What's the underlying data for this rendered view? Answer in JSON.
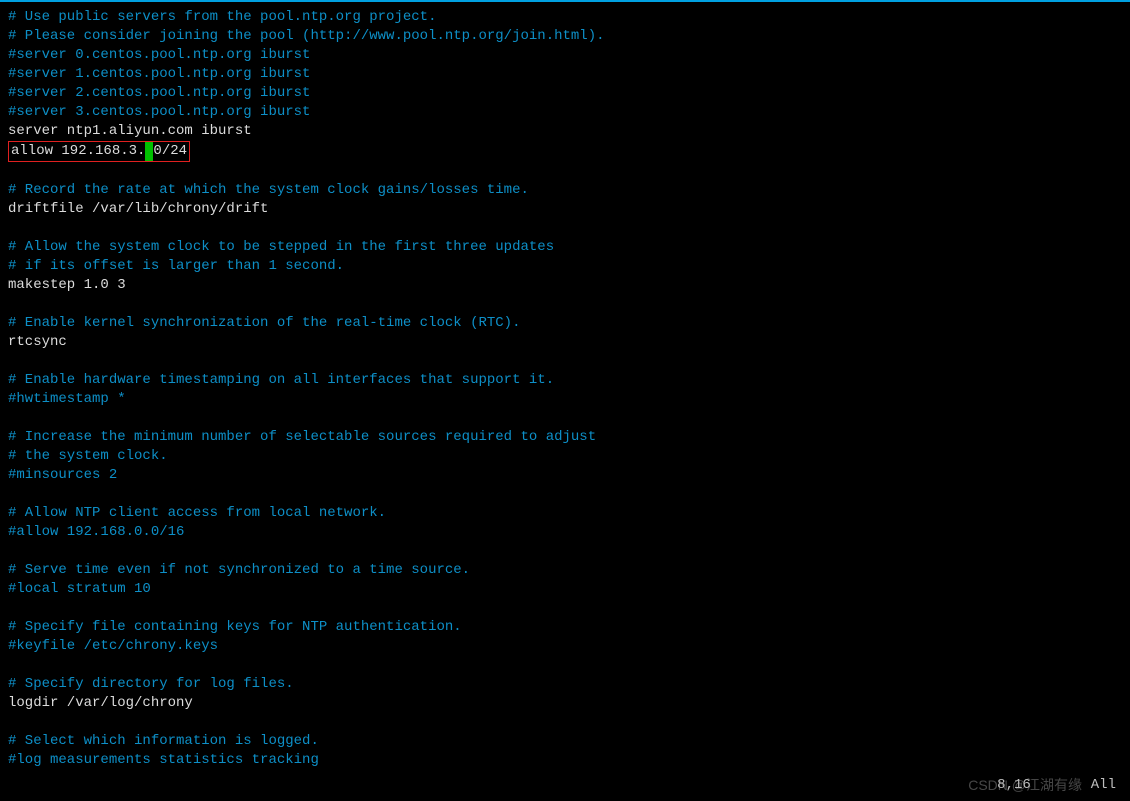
{
  "editor": {
    "cursor_position": "8,16",
    "scroll": "All",
    "highlighted_line": {
      "prefix": "allow 192.168.3.",
      "cursor_char": "0",
      "suffix": "0/24"
    },
    "lines": [
      {
        "type": "comment",
        "text": "# Use public servers from the pool.ntp.org project."
      },
      {
        "type": "comment",
        "text": "# Please consider joining the pool (http://www.pool.ntp.org/join.html)."
      },
      {
        "type": "comment",
        "text": "#server 0.centos.pool.ntp.org iburst"
      },
      {
        "type": "comment",
        "text": "#server 1.centos.pool.ntp.org iburst"
      },
      {
        "type": "comment",
        "text": "#server 2.centos.pool.ntp.org iburst"
      },
      {
        "type": "comment",
        "text": "#server 3.centos.pool.ntp.org iburst"
      },
      {
        "type": "normal",
        "text": "server ntp1.aliyun.com iburst"
      },
      {
        "type": "highlight"
      },
      {
        "type": "blank",
        "text": ""
      },
      {
        "type": "comment",
        "text": "# Record the rate at which the system clock gains/losses time."
      },
      {
        "type": "normal",
        "text": "driftfile /var/lib/chrony/drift"
      },
      {
        "type": "blank",
        "text": ""
      },
      {
        "type": "comment",
        "text": "# Allow the system clock to be stepped in the first three updates"
      },
      {
        "type": "comment",
        "text": "# if its offset is larger than 1 second."
      },
      {
        "type": "normal",
        "text": "makestep 1.0 3"
      },
      {
        "type": "blank",
        "text": ""
      },
      {
        "type": "comment",
        "text": "# Enable kernel synchronization of the real-time clock (RTC)."
      },
      {
        "type": "normal",
        "text": "rtcsync"
      },
      {
        "type": "blank",
        "text": ""
      },
      {
        "type": "comment",
        "text": "# Enable hardware timestamping on all interfaces that support it."
      },
      {
        "type": "comment",
        "text": "#hwtimestamp *"
      },
      {
        "type": "blank",
        "text": ""
      },
      {
        "type": "comment",
        "text": "# Increase the minimum number of selectable sources required to adjust"
      },
      {
        "type": "comment",
        "text": "# the system clock."
      },
      {
        "type": "comment",
        "text": "#minsources 2"
      },
      {
        "type": "blank",
        "text": ""
      },
      {
        "type": "comment",
        "text": "# Allow NTP client access from local network."
      },
      {
        "type": "comment",
        "text": "#allow 192.168.0.0/16"
      },
      {
        "type": "blank",
        "text": ""
      },
      {
        "type": "comment",
        "text": "# Serve time even if not synchronized to a time source."
      },
      {
        "type": "comment",
        "text": "#local stratum 10"
      },
      {
        "type": "blank",
        "text": ""
      },
      {
        "type": "comment",
        "text": "# Specify file containing keys for NTP authentication."
      },
      {
        "type": "comment",
        "text": "#keyfile /etc/chrony.keys"
      },
      {
        "type": "blank",
        "text": ""
      },
      {
        "type": "comment",
        "text": "# Specify directory for log files."
      },
      {
        "type": "normal",
        "text": "logdir /var/log/chrony"
      },
      {
        "type": "blank",
        "text": ""
      },
      {
        "type": "comment",
        "text": "# Select which information is logged."
      },
      {
        "type": "comment",
        "text": "#log measurements statistics tracking"
      }
    ]
  },
  "watermark": "CSDN @江湖有缘"
}
